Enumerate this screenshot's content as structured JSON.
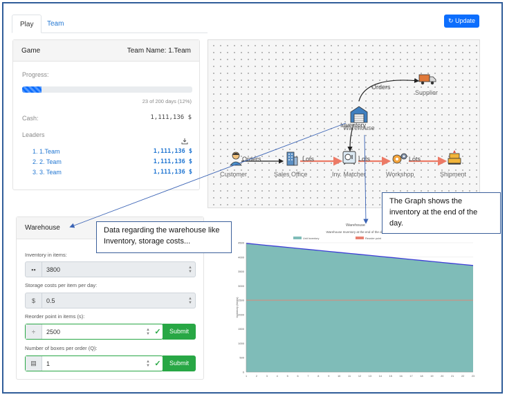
{
  "tabs": [
    {
      "label": "Play"
    },
    {
      "label": "Team"
    }
  ],
  "update_button": {
    "label": "Update"
  },
  "game_card": {
    "title": "Game",
    "team_name": "Team Name: 1.Team",
    "progress_label": "Progress:",
    "progress_fraction": 0.115,
    "progress_text": "23 of 200 days (12%)",
    "cash_label": "Cash:",
    "cash_value": "1,111,136 $",
    "leaders_label": "Leaders",
    "leaders": [
      {
        "name": "1. 1.Team",
        "cash": "1,111,136 $"
      },
      {
        "name": "2. 2. Team",
        "cash": "1,111,136 $"
      },
      {
        "name": "3. 3. Team",
        "cash": "1,111,136 $"
      }
    ]
  },
  "graph": {
    "nodes": {
      "customer": "Customer",
      "sales_office": "Sales Office",
      "inv_matcher": "Inv. Matcher",
      "workshop": "Workshop",
      "shipment": "Shipment",
      "warehouse": "Warehouse",
      "supplier": "Supplier"
    },
    "edges": {
      "customer_sales": "Orders",
      "sales_matcher": "Lots",
      "matcher_workshop": "Lots",
      "workshop_shipment": "Lots",
      "warehouse_supplier": "Orders",
      "warehouse_matcher": "Inventory"
    }
  },
  "warehouse_card": {
    "title": "Warehouse",
    "fields": [
      {
        "label": "Inventory in items:",
        "value": "3800",
        "icon": "grid-icon",
        "glyph": "▪▪"
      },
      {
        "label": "Storage costs per item per day:",
        "value": "0.5",
        "icon": "dollar-icon",
        "glyph": "$"
      },
      {
        "label": "Reorder point in items (s):",
        "value": "2500",
        "icon": "divide-icon",
        "glyph": "÷",
        "submit": "Submit"
      },
      {
        "label": "Number of boxes per order (Q):",
        "value": "1",
        "icon": "box-icon",
        "glyph": "▤",
        "submit": "Submit"
      }
    ]
  },
  "callouts": {
    "warehouse_note": "Data regarding the warehouse like Inventory, storage costs...",
    "graph_note": "The Graph shows the inventory at the end of the day."
  },
  "chart_data": {
    "type": "area",
    "title": "Warehouse",
    "subtitle": "Warehouse Inventory at the end of the day",
    "ylabel": "Inventory (Items)",
    "ylim": [
      0,
      4500
    ],
    "x": [
      1,
      2,
      3,
      4,
      5,
      6,
      7,
      8,
      9,
      10,
      11,
      12,
      13,
      14,
      15,
      16,
      17,
      18,
      19,
      20,
      21,
      22,
      23
    ],
    "series": [
      {
        "name": "Unit Inventory",
        "values": [
          4480,
          4445,
          4410,
          4375,
          4340,
          4305,
          4270,
          4235,
          4200,
          4165,
          4130,
          4095,
          4060,
          4025,
          3990,
          3955,
          3920,
          3885,
          3850,
          3815,
          3780,
          3745,
          3710
        ],
        "color": "#7fbcb8"
      },
      {
        "name": "Reorder point",
        "values": [
          2500,
          2500,
          2500,
          2500,
          2500,
          2500,
          2500,
          2500,
          2500,
          2500,
          2500,
          2500,
          2500,
          2500,
          2500,
          2500,
          2500,
          2500,
          2500,
          2500,
          2500,
          2500,
          2500
        ],
        "color": "#e98070"
      }
    ],
    "line_color": "#3d3dd6",
    "grid": true,
    "legend": "top"
  }
}
